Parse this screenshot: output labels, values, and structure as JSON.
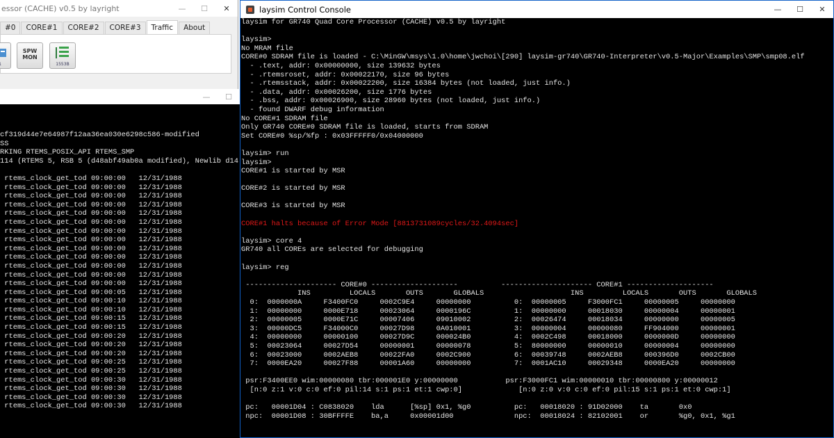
{
  "bg_window": {
    "title": "essor (CACHE) v0.5 by layright",
    "controls": [
      "—",
      "☐",
      "✕"
    ],
    "tabs": [
      "#0",
      "CORE#1",
      "CORE#2",
      "CORE#3",
      "Traffic",
      "About"
    ],
    "selected_tab": "Traffic",
    "buttons": [
      {
        "name": "device-a-button",
        "label": "—1"
      },
      {
        "name": "spw-mon-button",
        "label": "SPW\nMON"
      },
      {
        "name": "device-c-button",
        "label": "1553B"
      }
    ]
  },
  "left_console": {
    "controls": [
      "—",
      "☐"
    ],
    "lines": [
      "cf319d44e7e64987f12aa36ea030e6298c586-modified",
      "SS",
      "RKING RTEMS_POSIX_API RTEMS_SMP",
      "114 (RTEMS 5, RSB 5 (d48abf49ab0a modified), Newlib d14",
      "",
      " rtems_clock_get_tod 09:00:00   12/31/1988",
      " rtems_clock_get_tod 09:00:00   12/31/1988",
      " rtems_clock_get_tod 09:00:00   12/31/1988",
      " rtems_clock_get_tod 09:00:00   12/31/1988",
      " rtems_clock_get_tod 09:00:00   12/31/1988",
      " rtems_clock_get_tod 09:00:00   12/31/1988",
      " rtems_clock_get_tod 09:00:00   12/31/1988",
      " rtems_clock_get_tod 09:00:00   12/31/1988",
      " rtems_clock_get_tod 09:00:00   12/31/1988",
      " rtems_clock_get_tod 09:00:00   12/31/1988",
      " rtems_clock_get_tod 09:00:00   12/31/1988",
      " rtems_clock_get_tod 09:00:00   12/31/1988",
      " rtems_clock_get_tod 09:00:00   12/31/1988",
      " rtems_clock_get_tod 09:00:05   12/31/1988",
      " rtems_clock_get_tod 09:00:10   12/31/1988",
      " rtems_clock_get_tod 09:00:10   12/31/1988",
      " rtems_clock_get_tod 09:00:15   12/31/1988",
      " rtems_clock_get_tod 09:00:15   12/31/1988",
      " rtems_clock_get_tod 09:00:20   12/31/1988",
      " rtems_clock_get_tod 09:00:20   12/31/1988",
      " rtems_clock_get_tod 09:00:20   12/31/1988",
      " rtems_clock_get_tod 09:00:25   12/31/1988",
      " rtems_clock_get_tod 09:00:25   12/31/1988",
      " rtems_clock_get_tod 09:00:30   12/31/1988",
      " rtems_clock_get_tod 09:00:30   12/31/1988",
      " rtems_clock_get_tod 09:00:30   12/31/1988",
      " rtems_clock_get_tod 09:00:30   12/31/1988"
    ]
  },
  "main_console": {
    "title": "laysim Control Console",
    "controls": [
      "—",
      "☐",
      "✕"
    ],
    "accent_color": "#1060c8",
    "error_color": "#e01818",
    "lines": [
      {
        "text": "laysim for GR740 Quad Core Processor (CACHE) v0.5 by layright"
      },
      {
        "text": ""
      },
      {
        "text": "laysim>"
      },
      {
        "text": "No MRAM file"
      },
      {
        "text": "CORE#0 SDRAM file is loaded - C:\\MinGW\\msys\\1.0\\home\\jwchoi\\[290] laysim-gr740\\GR740-Interpreter\\v0.5-Major\\Examples\\SMP\\smp08.elf"
      },
      {
        "text": "  - .text, addr: 0x00000000, size 139632 bytes"
      },
      {
        "text": "  - .rtemsroset, addr: 0x00022170, size 96 bytes"
      },
      {
        "text": "  - .rtemsstack, addr: 0x00022200, size 16384 bytes (not loaded, just info.)"
      },
      {
        "text": "  - .data, addr: 0x00026200, size 1776 bytes"
      },
      {
        "text": "  - .bss, addr: 0x00026900, size 28960 bytes (not loaded, just info.)"
      },
      {
        "text": "  - found DWARF debug information"
      },
      {
        "text": "No CORE#1 SDRAM file"
      },
      {
        "text": "Only GR740 CORE#0 SDRAM file is loaded, starts from SDRAM"
      },
      {
        "text": "Set CORE#0 %sp/%fp : 0x03FFFFF0/0x04000000"
      },
      {
        "text": ""
      },
      {
        "text": "laysim> run"
      },
      {
        "text": "laysim>"
      },
      {
        "text": "CORE#1 is started by MSR"
      },
      {
        "text": ""
      },
      {
        "text": "CORE#2 is started by MSR"
      },
      {
        "text": ""
      },
      {
        "text": "CORE#3 is started by MSR"
      },
      {
        "text": ""
      },
      {
        "text": "CORE#1 halts because of Error Mode [8813731089cycles/32.4094sec]",
        "error": true
      },
      {
        "text": ""
      },
      {
        "text": "laysim> core 4"
      },
      {
        "text": "GR740 all COREs are selected for debugging"
      },
      {
        "text": ""
      },
      {
        "text": "laysim> reg"
      },
      {
        "text": ""
      },
      {
        "text": " --------------------- CORE#0 --------------------          --------------------- CORE#1 --------------------"
      },
      {
        "text": "             INS         LOCALS       OUTS       GLOBALS                    INS         LOCALS       OUTS       GLOBALS"
      },
      {
        "text": "  0:  0000000A     F3400FC0     0002C9E4     00000000          0:  00000005     F3000FC1     00000005     00000000"
      },
      {
        "text": "  1:  00000000     0000E718     00023064     0000196C          1:  00000000     00018030     00000004     00000001"
      },
      {
        "text": "  2:  00000005     0000E71C     00007406     09010002          2:  00026474     00018034     00000000     00000005"
      },
      {
        "text": "  3:  00000DC5     F34000C0     00027D98     0A010001          3:  00000004     00000080     FF904000     00000001"
      },
      {
        "text": "  4:  00000000     00000100     00027D9C     000024B0          4:  0002C498     00018000     0000000D     00000000"
      },
      {
        "text": "  5:  00023064     00027D54     00000001     00000078          5:  80000000     00000010     00000004     00000000"
      },
      {
        "text": "  6:  00023000     0002AEB8     00022FA0     0002C900          6:  00039748     0002AEB8     000396D0     0002CB00"
      },
      {
        "text": "  7:  0000EA20     00027F88     00001A60     00000000          7:  0001AC10     00029348     0000EA20     00000000"
      },
      {
        "text": ""
      },
      {
        "text": " psr:F3400EE0 wim:00000080 tbr:000001E0 y:00000000           psr:F3000FC1 wim:00000010 tbr:00000800 y:00000012"
      },
      {
        "text": "  [n:0 z:1 v:0 c:0 ef:0 pil:14 s:1 ps:1 et:1 cwp:0]             [n:0 z:0 v:0 c:0 ef:0 pil:15 s:1 ps:1 et:0 cwp:1]"
      },
      {
        "text": ""
      },
      {
        "text": " pc:   00001D04 : C0838020    lda      [%sp] 0x1, %g0          pc:   00018020 : 91D02000    ta       0x0"
      },
      {
        "text": " npc:  00001D08 : 30BFFFFE    ba,a     0x00001d00              npc:  00018024 : 82102001    or       %g0, 0x1, %g1"
      }
    ]
  }
}
